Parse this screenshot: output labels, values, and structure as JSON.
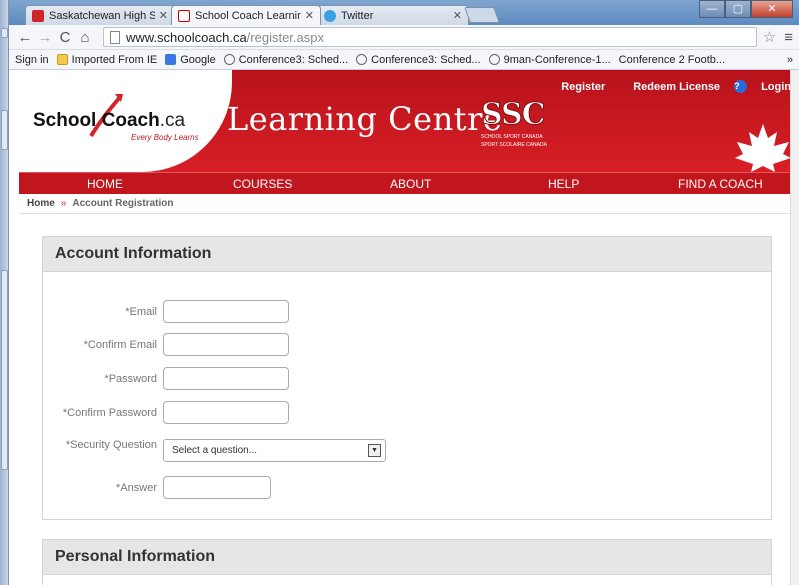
{
  "browser": {
    "tabs": [
      {
        "label": "Saskatchewan High Schoo"
      },
      {
        "label": "School Coach Learning Ce"
      },
      {
        "label": "Twitter"
      }
    ],
    "address": {
      "host": "www.schoolcoach.ca",
      "path": "/register.aspx"
    },
    "bookmarks": [
      {
        "label": "Sign in"
      },
      {
        "label": "Imported From IE"
      },
      {
        "label": "Google"
      },
      {
        "label": "Conference3: Sched..."
      },
      {
        "label": "Conference3: Sched..."
      },
      {
        "label": "9man-Conference-1..."
      },
      {
        "label": "Conference 2 Footb..."
      }
    ],
    "bookmarks_more": "»"
  },
  "header": {
    "logo_school": "School",
    "logo_coach": "Coach",
    "logo_ca": ".ca",
    "logo_tagline": "Every Body Learns",
    "title": "Learning Centre",
    "ssc_mark": "SSC",
    "ssc_sub1": "SCHOOL SPORT CANADA",
    "ssc_sub2": "SPORT SCOLAIRE CANADA",
    "top_links": {
      "register": "Register",
      "redeem": "Redeem License",
      "login": "Login"
    }
  },
  "nav": {
    "home": "HOME",
    "courses": "COURSES",
    "about": "ABOUT",
    "help": "HELP",
    "find": "FIND A COACH"
  },
  "breadcrumb": {
    "home": "Home",
    "sep": "»",
    "current": "Account Registration"
  },
  "account": {
    "heading": "Account Information",
    "email": "*Email",
    "confirm_email": "*Confirm Email",
    "password": "*Password",
    "confirm_password": "*Confirm Password",
    "security_question": "*Security Question",
    "security_placeholder": "Select a question...",
    "answer": "*Answer"
  },
  "personal": {
    "heading": "Personal Information"
  }
}
